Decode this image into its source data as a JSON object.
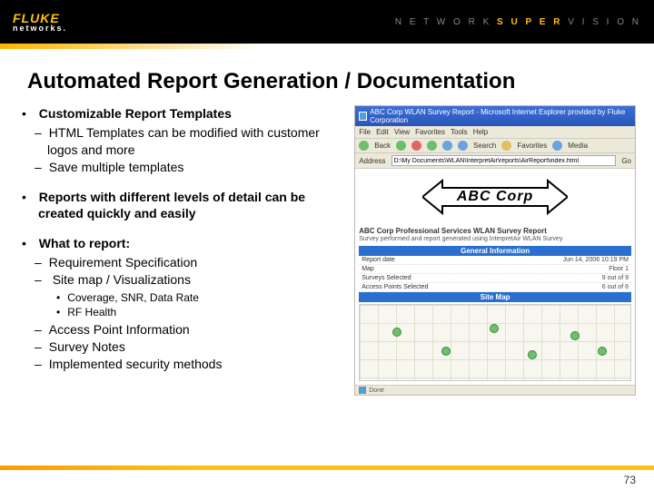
{
  "header": {
    "brand_main": "FLUKE",
    "brand_sub": "networks.",
    "tagline_prefix": "N E T W O R K",
    "tagline_highlight": "S U P E R",
    "tagline_suffix": "V I S I O N"
  },
  "title": "Automated Report Generation / Documentation",
  "bullets": {
    "b1": "Customizable Report Templates",
    "b1_1": "HTML Templates can be modified with customer logos and more",
    "b1_2": "Save multiple templates",
    "b2": "Reports with different levels of detail can be created quickly and easily",
    "b3": "What to report:",
    "b3_1": "Requirement Specification",
    "b3_2": "Site map / Visualizations",
    "b3_2_1": "Coverage, SNR, Data Rate",
    "b3_2_2": "RF Health",
    "b3_3": "Access Point Information",
    "b3_4": "Survey Notes",
    "b3_5": "Implemented security methods"
  },
  "browser": {
    "window_title": "ABC Corp WLAN Survey Report - Microsoft Internet Explorer provided by Fluke Corporation",
    "menu_file": "File",
    "menu_edit": "Edit",
    "menu_view": "View",
    "menu_favorites": "Favorites",
    "menu_tools": "Tools",
    "menu_help": "Help",
    "tb_back": "Back",
    "tb_search": "Search",
    "tb_favorites": "Favorites",
    "tb_media": "Media",
    "addr_label": "Address",
    "addr_value": "D:\\My Documents\\WLAN\\InterpretAir\\reports\\AirReport\\index.html",
    "go": "Go",
    "status": "Done"
  },
  "report": {
    "company": "ABC Corp",
    "title": "ABC Corp Professional Services WLAN Survey Report",
    "subtitle": "Survey performed and report generated using InterpretAir WLAN Survey",
    "section_general": "General Information",
    "section_sitemap": "Site Map",
    "rows": {
      "r1k": "Report date",
      "r1v": "Jun 14, 2006 10:19 PM",
      "r2k": "Map",
      "r2v": "Floor 1",
      "r3k": "Surveys Selected",
      "r3v": "9 out of 9",
      "r4k": "Access Points Selected",
      "r4v": "6 out of 6"
    }
  },
  "page_number": "73"
}
